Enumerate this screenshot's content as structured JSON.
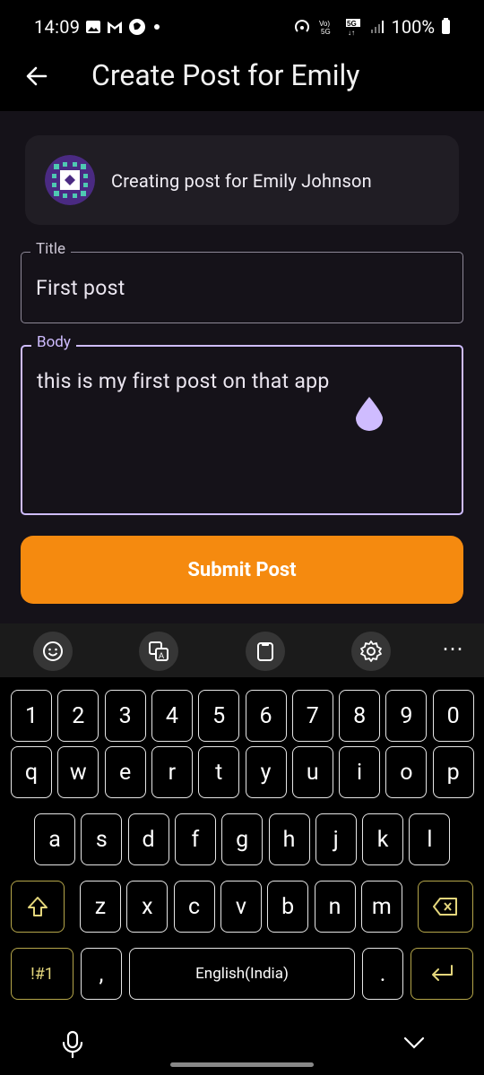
{
  "status_bar": {
    "time": "14:09",
    "battery": "100%",
    "net_label": "5G"
  },
  "app_bar": {
    "title": "Create Post for Emily"
  },
  "user_card": {
    "text": "Creating post for Emily Johnson"
  },
  "form": {
    "title_label": "Title",
    "title_value": "First post",
    "body_label": "Body",
    "body_value": "this is my first post on that app",
    "submit_label": "Submit Post"
  },
  "colors": {
    "accent": "#cfbcff",
    "submit": "#f58a0f",
    "surface": "#151219",
    "card": "#201d24"
  },
  "keyboard": {
    "toolbar": [
      "emoji-icon",
      "translate-icon",
      "clipboard-icon",
      "settings-icon",
      "more-icon"
    ],
    "row_numbers": [
      "1",
      "2",
      "3",
      "4",
      "5",
      "6",
      "7",
      "8",
      "9",
      "0"
    ],
    "row_top": [
      "q",
      "w",
      "e",
      "r",
      "t",
      "y",
      "u",
      "i",
      "o",
      "p"
    ],
    "row_middle": [
      "a",
      "s",
      "d",
      "f",
      "g",
      "h",
      "j",
      "k",
      "l"
    ],
    "row_bottom": [
      "z",
      "x",
      "c",
      "v",
      "b",
      "n",
      "m"
    ],
    "symbols_key": "!#1",
    "comma_key": ",",
    "space_label": "English(India)",
    "period_key": "."
  }
}
